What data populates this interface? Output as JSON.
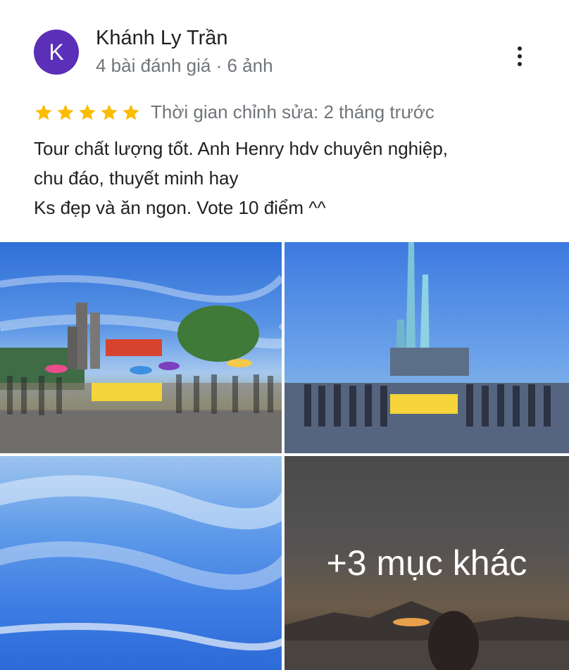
{
  "reviewer": {
    "avatar_letter": "K",
    "name": "Khánh Ly Trần",
    "meta": "4 bài đánh giá · 6 ảnh"
  },
  "rating": {
    "stars": 5,
    "edited": "Thời gian chỉnh sửa: 2 tháng trước"
  },
  "review": {
    "lines": [
      "Tour chất lượng tốt. Anh Henry hdv chuyên nghiệp,",
      "chu đáo, thuyết minh hay",
      "Ks đẹp và ăn ngon. Vote 10 điểm ^^"
    ]
  },
  "photos": {
    "items": [
      {
        "icon": "group-photo-rock-gate"
      },
      {
        "icon": "group-photo-monument"
      },
      {
        "icon": "sky-photo"
      },
      {
        "icon": "sunset-photo"
      }
    ],
    "more_label": "+3 mục khác"
  },
  "colors": {
    "avatar": "#5b2fb8",
    "star": "#fbbc04",
    "secondary_text": "#70757a"
  }
}
